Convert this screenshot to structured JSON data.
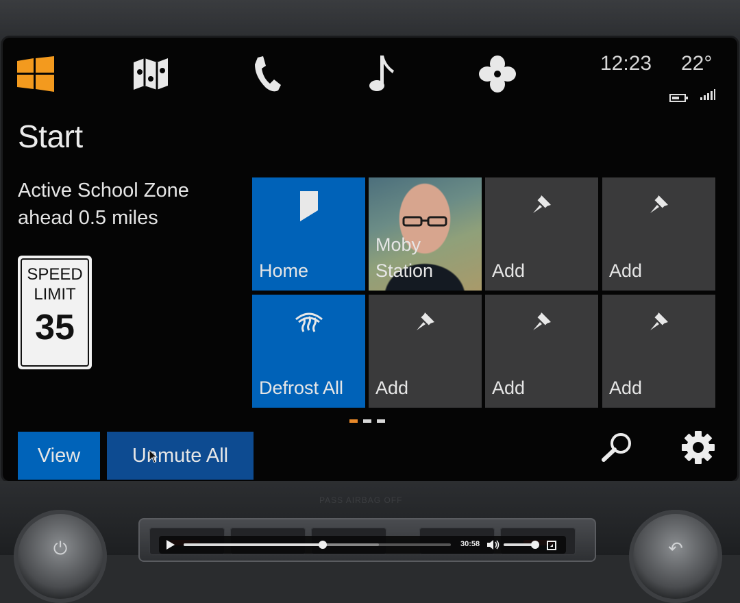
{
  "status": {
    "time": "12:23",
    "temperature": "22°"
  },
  "nav": {
    "icons": [
      "windows-icon",
      "map-icon",
      "phone-icon",
      "music-icon",
      "fan-icon"
    ]
  },
  "page": {
    "title": "Start"
  },
  "alert": {
    "line1": "Active School Zone",
    "line2": "ahead 0.5 miles"
  },
  "speed_sign": {
    "line1": "SPEED",
    "line2": "LIMIT",
    "value": "35"
  },
  "tiles": [
    {
      "label": "Home",
      "style": "blue",
      "icon": "bookmark-icon"
    },
    {
      "label_line1": "Moby",
      "label_line2": "Station",
      "style": "photo"
    },
    {
      "label": "Add",
      "style": "gray",
      "icon": "pin-icon"
    },
    {
      "label": "Add",
      "style": "gray",
      "icon": "pin-icon"
    },
    {
      "label": "Defrost All",
      "style": "blue",
      "icon": "defrost-icon"
    },
    {
      "label": "Add",
      "style": "gray",
      "icon": "pin-icon"
    },
    {
      "label": "Add",
      "style": "gray",
      "icon": "pin-icon"
    },
    {
      "label": "Add",
      "style": "gray",
      "icon": "pin-icon"
    }
  ],
  "pager": {
    "count": 3,
    "active": 0
  },
  "buttons": {
    "view": "View",
    "unmute": "Unmute All"
  },
  "console": {
    "airbag": "PASS AIRBAG OFF"
  },
  "player": {
    "time": "30:58",
    "progress": 0.52,
    "buffered": 0.73,
    "volume": 0.88
  },
  "colors": {
    "tile_blue": "#0062b8",
    "tile_gray": "#3a3a3b",
    "accent_orange": "#f39a1e",
    "button_blue": "#0063b9",
    "button_dark_blue": "#0d4b91"
  }
}
